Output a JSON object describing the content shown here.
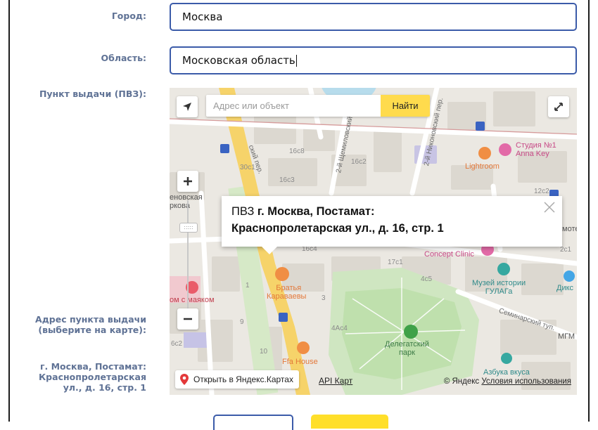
{
  "form": {
    "city_label": "Город:",
    "city_value": "Москва",
    "region_label": "Область:",
    "region_value": "Московская область",
    "pickup_label": "Пункт выдачи (ПВЗ):",
    "address_label_line1": "Адрес пункта выдачи",
    "address_label_line2": "(выберите на карте):",
    "selected_address_line1": "г. Москва, Постамат:",
    "selected_address_line2": "Краснопролетарская",
    "selected_address_line3": "ул., д. 16, стр. 1"
  },
  "map": {
    "search_placeholder": "Адрес или объект",
    "find_button": "Найти",
    "balloon_prefix": "ПВЗ ",
    "balloon_bold_line1": "г. Москва, Постамат:",
    "balloon_bold_line2": "Краснопролетарская ул., д. 16, стр. 1",
    "open_in_yandex": "Открыть в Яндекс.Картах",
    "api_link": "API Карт",
    "copyright_prefix": "© Яндекс",
    "terms": "Условия использования",
    "labels": {
      "poi_brothers_line1": "Братья",
      "poi_brothers_line2": "Караваевы",
      "poi_ffa": "Ffa House",
      "poi_lightroom": "Lightroom",
      "poi_studio_line1": "Студия №1",
      "poi_studio_line2": "Anna Key",
      "poi_concept": "Concept Clinic",
      "poi_museum_line1": "Музей истории",
      "poi_museum_line2": "ГУЛАГа",
      "poi_park_line1": "Делегатский",
      "poi_park_line2": "парк",
      "poi_azbuka": "Азбука вкуса",
      "poi_diks": "Дикс",
      "poi_mgm": "МГМ",
      "poi_mayak": "ом с маяком",
      "poi_left_park_line1": "еновская",
      "poi_left_park_line2": "ркова",
      "poi_right_edge": "мотеl",
      "street_seminarsky": "Семинарский туп.",
      "street_shchemilovsky": "2-й Щемиловский пер.",
      "street_nikonovsky": "2-й Никоновский пер.",
      "street_left_per": "ский пер.",
      "h_16c8": "16с8",
      "h_30c1": "30с1",
      "h_16c3": "16с3",
      "h_16c2": "16с2",
      "h_16c4": "16с4",
      "h_17c1": "17с1",
      "h_4c5": "4с5",
      "h_4ac4": "4Ас4",
      "h_12c2": "12с2",
      "h_9": "9",
      "h_6c2": "6с2",
      "h_2c1": "2с1",
      "h_10": "10",
      "h_3": "3",
      "h_1": "1"
    }
  }
}
